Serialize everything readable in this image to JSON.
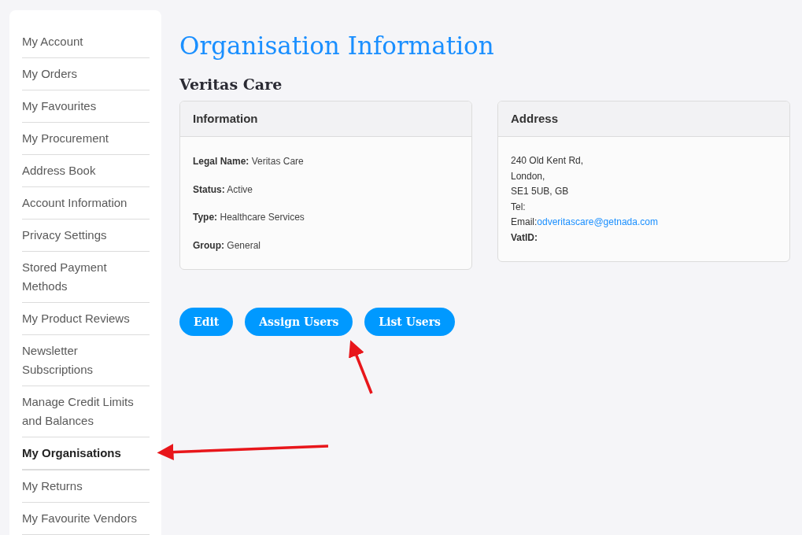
{
  "sidebar": {
    "items": [
      {
        "label": "My Account",
        "selected": false
      },
      {
        "label": "My Orders",
        "selected": false
      },
      {
        "label": "My Favourites",
        "selected": false
      },
      {
        "label": "My Procurement",
        "selected": false
      },
      {
        "label": "Address Book",
        "selected": false
      },
      {
        "label": "Account Information",
        "selected": false
      },
      {
        "label": "Privacy Settings",
        "selected": false
      },
      {
        "label": "Stored Payment Methods",
        "selected": false
      },
      {
        "label": "My Product Reviews",
        "selected": false
      },
      {
        "label": "Newsletter Subscriptions",
        "selected": false
      },
      {
        "label": "Manage Credit Limits and Balances",
        "selected": false
      },
      {
        "label": "My Organisations",
        "selected": true
      },
      {
        "label": "My Returns",
        "selected": false
      },
      {
        "label": "My Favourite Vendors",
        "selected": false
      }
    ]
  },
  "page_title": "Organisation Information",
  "organisation_name": "Veritas Care",
  "information_card": {
    "title": "Information",
    "fields": [
      {
        "label": "Legal Name:",
        "value": "Veritas Care"
      },
      {
        "label": "Status:",
        "value": "Active"
      },
      {
        "label": "Type:",
        "value": "Healthcare Services"
      },
      {
        "label": "Group:",
        "value": "General"
      }
    ]
  },
  "address_card": {
    "title": "Address",
    "lines": [
      {
        "kind": "text",
        "text": "240 Old Kent Rd,"
      },
      {
        "kind": "text",
        "text": "London,"
      },
      {
        "kind": "text",
        "text": "SE1 5UB, GB"
      },
      {
        "kind": "text",
        "text": "Tel:"
      },
      {
        "kind": "email",
        "label": "Email:",
        "link": "odveritascare@getnada.com"
      },
      {
        "kind": "bold",
        "text": "VatID:"
      }
    ]
  },
  "buttons": [
    "Edit",
    "Assign Users",
    "List Users"
  ]
}
